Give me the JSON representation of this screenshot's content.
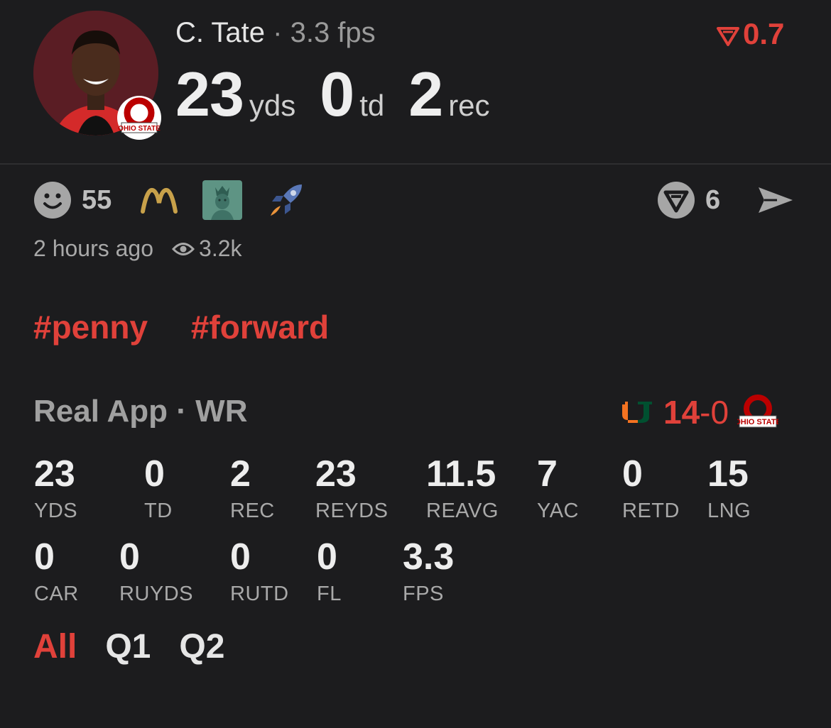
{
  "header": {
    "player_name": "C. Tate",
    "separator": "·",
    "fps_label": "3.3 fps",
    "yds_value": "23",
    "yds_unit": "yds",
    "td_value": "0",
    "td_unit": "td",
    "rec_value": "2",
    "rec_unit": "rec",
    "score_value": "0.7",
    "team_logo_text": "OHIO STATE"
  },
  "reactions": {
    "smile_count": "55",
    "emojis": [
      "smile-icon",
      "m-logo-icon",
      "statue-of-liberty-icon",
      "rocket-icon"
    ],
    "vote_count": "6"
  },
  "meta": {
    "time_ago": "2 hours ago",
    "views": "3.2k"
  },
  "tags": [
    "#penny",
    "#forward"
  ],
  "game": {
    "title": "Real App · WR",
    "home_score": "14",
    "dash": "-",
    "away_score": "0",
    "away_logo_text": "OHIO STATE"
  },
  "stats": [
    {
      "value": "23",
      "label": "YDS"
    },
    {
      "value": "0",
      "label": "TD"
    },
    {
      "value": "2",
      "label": "REC"
    },
    {
      "value": "23",
      "label": "REYDS"
    },
    {
      "value": "11.5",
      "label": "REAVG"
    },
    {
      "value": "7",
      "label": "YAC"
    },
    {
      "value": "0",
      "label": "RETD"
    },
    {
      "value": "15",
      "label": "LNG"
    },
    {
      "value": "0",
      "label": "CAR"
    },
    {
      "value": "0",
      "label": "RUYDS"
    },
    {
      "value": "0",
      "label": "RUTD"
    },
    {
      "value": "0",
      "label": "FL"
    },
    {
      "value": "3.3",
      "label": "FPS"
    }
  ],
  "tabs": [
    "All",
    "Q1",
    "Q2"
  ],
  "colors": {
    "accent": "#e0413a",
    "background": "#1c1c1e",
    "ohio_red": "#bb0000",
    "miami_orange": "#f47321",
    "miami_green": "#005030"
  }
}
